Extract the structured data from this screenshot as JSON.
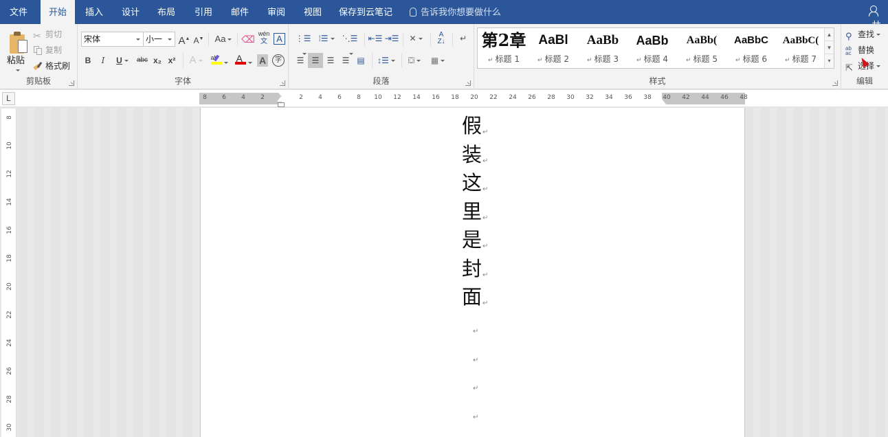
{
  "tabs": [
    {
      "label": "文件",
      "active": false
    },
    {
      "label": "开始",
      "active": true
    },
    {
      "label": "插入",
      "active": false
    },
    {
      "label": "设计",
      "active": false
    },
    {
      "label": "布局",
      "active": false
    },
    {
      "label": "引用",
      "active": false
    },
    {
      "label": "邮件",
      "active": false
    },
    {
      "label": "审阅",
      "active": false
    },
    {
      "label": "视图",
      "active": false
    },
    {
      "label": "保存到云笔记",
      "active": false
    }
  ],
  "tell_me": {
    "placeholder": "告诉我你想要做什么",
    "icon": "lightbulb-icon"
  },
  "share": {
    "icon": "share-person-icon",
    "label": "共"
  },
  "clipboard": {
    "group_label": "剪贴板",
    "paste_label": "粘贴",
    "cut_label": "剪切",
    "copy_label": "复制",
    "format_painter_label": "格式刷"
  },
  "font": {
    "group_label": "字体",
    "font_name": "宋体",
    "font_size": "小一",
    "grow_label": "A",
    "shrink_label": "A",
    "change_case_label": "Aa",
    "phonetic_label": "wén",
    "char_border_label": "A",
    "bold_label": "B",
    "italic_label": "I",
    "underline_label": "U",
    "strikethrough_label": "abc",
    "subscript_label": "x₂",
    "superscript_label": "x²",
    "text_effects_label": "A",
    "highlight_label": "ab",
    "font_color_label": "A",
    "char_shading_label": "A",
    "enclose_label": "字",
    "highlight_color": "#ffff00",
    "font_color": "#e00000"
  },
  "paragraph": {
    "group_label": "段落",
    "alignment_selected": "center"
  },
  "styles": {
    "group_label": "样式",
    "items": [
      {
        "sample": "第2章",
        "name": "标题 1"
      },
      {
        "sample": "AaBl",
        "name": "标题 2"
      },
      {
        "sample": "AaBb",
        "name": "标题 3"
      },
      {
        "sample": "AaBb",
        "name": "标题 4"
      },
      {
        "sample": "AaBb(",
        "name": "标题 5"
      },
      {
        "sample": "AaBbC",
        "name": "标题 6"
      },
      {
        "sample": "AaBbC(",
        "name": "标题 7"
      }
    ]
  },
  "editing": {
    "group_label": "编辑",
    "find_label": "查找",
    "replace_label": "替换",
    "select_label": "选择"
  },
  "ruler": {
    "tab_selector": "L",
    "left_margin_ticks": [
      "8",
      "6",
      "4",
      "2"
    ],
    "ticks": [
      "2",
      "4",
      "6",
      "8",
      "10",
      "12",
      "14",
      "16",
      "18",
      "20",
      "22",
      "24",
      "26",
      "28",
      "30",
      "32",
      "34",
      "36",
      "38",
      "40",
      "42",
      "44",
      "46",
      "48"
    ],
    "vertical_ticks": [
      "8",
      "10",
      "12",
      "14",
      "16",
      "18",
      "20",
      "22",
      "24",
      "26",
      "28",
      "30"
    ]
  },
  "document": {
    "vertical_text": [
      "假",
      "装",
      "这",
      "里",
      "是",
      "封",
      "面"
    ],
    "paragraph_mark": "↵",
    "empty_paragraphs": 4
  }
}
